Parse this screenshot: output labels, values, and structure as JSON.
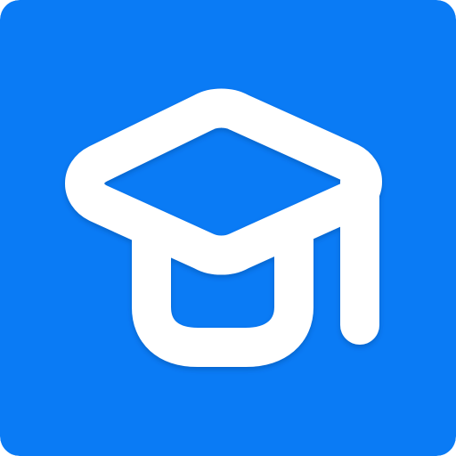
{
  "app_icon": {
    "name": "graduation-cap-icon",
    "background_color": "#0A7BF5",
    "glyph_color": "#FFFFFF"
  }
}
